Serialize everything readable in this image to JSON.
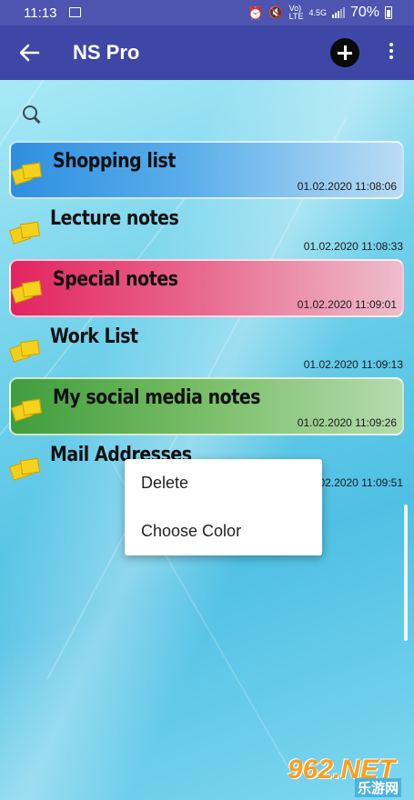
{
  "status_bar": {
    "time": "11:13",
    "network_small_top": "Vo)",
    "network_small_bottom": "LTE",
    "network_gen": "4.5G",
    "battery": "70%"
  },
  "app_bar": {
    "title": "NS Pro",
    "back_icon": "arrow-left-icon",
    "add_icon": "plus-circle-icon",
    "more_icon": "more-vert-icon"
  },
  "search": {
    "icon": "search-icon"
  },
  "notes": [
    {
      "title": "Shopping list",
      "timestamp": "01.02.2020 11:08:06",
      "color": "#3a9be8",
      "style": "colored"
    },
    {
      "title": "Lecture notes",
      "timestamp": "01.02.2020 11:08:33",
      "color": "",
      "style": "plain"
    },
    {
      "title": "Special notes",
      "timestamp": "01.02.2020 11:09:01",
      "color": "#e8336a",
      "style": "colored"
    },
    {
      "title": "Work List",
      "timestamp": "01.02.2020 11:09:13",
      "color": "",
      "style": "plain"
    },
    {
      "title": "My social media notes",
      "timestamp": "01.02.2020 11:09:26",
      "color": "#4caa48",
      "style": "colored"
    },
    {
      "title": "Mail Addresses",
      "timestamp": "01.02.2020 11:09:51",
      "color": "",
      "style": "plain"
    }
  ],
  "context_menu": {
    "items": [
      "Delete",
      "Choose Color"
    ]
  },
  "watermark": {
    "logo": "962.NET",
    "sub": "乐游网"
  }
}
